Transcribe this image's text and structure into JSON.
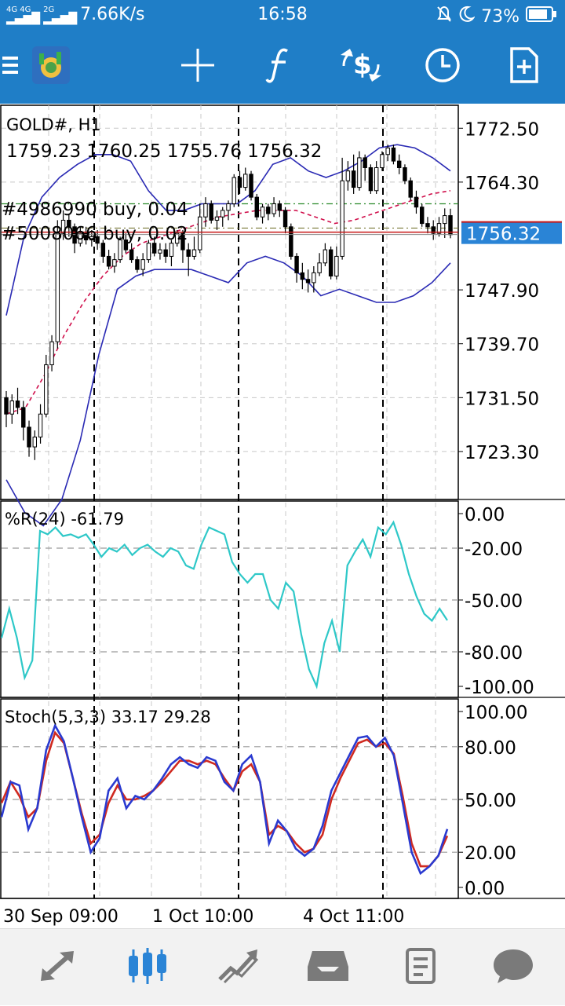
{
  "status_bar": {
    "network_top": "4G 4G",
    "network_2g": "2G",
    "speed": "7.66K/s",
    "time": "16:58",
    "battery": "73%"
  },
  "toolbar": {
    "icons": [
      "menu-icon",
      "app-logo-icon",
      "crosshair-icon",
      "function-icon",
      "trade-icon",
      "clock-icon",
      "new-document-icon"
    ]
  },
  "chart": {
    "symbol": "GOLD#, H1",
    "ohlc": "1759.23 1760.25 1755.76 1756.32",
    "order1": "#4986990 buy, 0.04",
    "order2": "#5008066 buy, 0.02",
    "current_price": "1756.32",
    "price_ticks": [
      "1772.50",
      "1764.30",
      "1747.90",
      "1739.70",
      "1731.50",
      "1723.30"
    ],
    "wr_label": "%R(24) -61.79",
    "wr_ticks": [
      "0.00",
      "-20.00",
      "-50.00",
      "-80.00",
      "-100.00"
    ],
    "stoch_label": "Stoch(5,3,3) 33.17 29.28",
    "stoch_ticks": [
      "100.00",
      "80.00",
      "50.00",
      "20.00",
      "0.00"
    ],
    "time_labels": [
      "30 Sep 09:00",
      "1 Oct 10:00",
      "4 Oct 11:00"
    ],
    "colors": {
      "bullish_body": "#ffffff",
      "bearish_body": "#000000",
      "bollinger": "#2a2ab4",
      "ma": "#d0104c",
      "wr_line": "#2ec8c8",
      "stoch_main": "#2a3ad0",
      "stoch_signal": "#d02a20",
      "price_marker_bg": "#2a84d6",
      "order_line": "#c81818"
    }
  },
  "chart_data": [
    {
      "type": "candlestick",
      "title": "GOLD#, H1",
      "ylim": [
        1716.0,
        1776.0
      ],
      "y_ticks": [
        1772.5,
        1764.3,
        1747.9,
        1739.7,
        1731.5,
        1723.3
      ],
      "current_price": 1756.32,
      "candles": [
        [
          1731.5,
          1729.0,
          1732.5,
          1727.0
        ],
        [
          1729.0,
          1731.0,
          1732.0,
          1727.5
        ],
        [
          1731.0,
          1730.0,
          1733.0,
          1729.0
        ],
        [
          1730.0,
          1727.0,
          1731.0,
          1725.0
        ],
        [
          1727.0,
          1724.0,
          1728.0,
          1722.5
        ],
        [
          1724.0,
          1725.5,
          1726.5,
          1722.0
        ],
        [
          1725.5,
          1729.0,
          1730.5,
          1724.5
        ],
        [
          1729.0,
          1736.5,
          1738.0,
          1728.5
        ],
        [
          1736.5,
          1740.0,
          1741.0,
          1735.5
        ],
        [
          1740.0,
          1756.5,
          1758.5,
          1739.0
        ],
        [
          1756.5,
          1758.5,
          1760.0,
          1755.5
        ],
        [
          1758.5,
          1757.5,
          1759.5,
          1756.0
        ],
        [
          1757.5,
          1755.0,
          1758.0,
          1753.5
        ],
        [
          1755.0,
          1756.5,
          1757.5,
          1754.5
        ],
        [
          1756.5,
          1755.5,
          1757.5,
          1754.8
        ],
        [
          1755.5,
          1756.0,
          1757.0,
          1754.5
        ],
        [
          1756.0,
          1755.0,
          1757.0,
          1754.0
        ],
        [
          1755.0,
          1753.0,
          1755.5,
          1752.0
        ],
        [
          1753.0,
          1751.5,
          1754.0,
          1751.0
        ],
        [
          1751.5,
          1752.5,
          1753.5,
          1750.5
        ],
        [
          1752.5,
          1755.5,
          1756.0,
          1752.0
        ],
        [
          1755.5,
          1754.0,
          1756.5,
          1753.5
        ],
        [
          1754.0,
          1752.5,
          1755.0,
          1752.0
        ],
        [
          1752.5,
          1751.0,
          1753.0,
          1750.5
        ],
        [
          1751.0,
          1752.5,
          1753.5,
          1750.0
        ],
        [
          1752.5,
          1755.0,
          1755.5,
          1752.0
        ],
        [
          1755.0,
          1753.5,
          1756.0,
          1753.0
        ],
        [
          1753.5,
          1754.0,
          1755.0,
          1752.5
        ],
        [
          1754.0,
          1753.0,
          1755.0,
          1752.0
        ],
        [
          1753.0,
          1755.0,
          1755.5,
          1751.5
        ],
        [
          1755.0,
          1756.5,
          1757.0,
          1754.5
        ],
        [
          1756.5,
          1754.0,
          1757.0,
          1752.0
        ],
        [
          1754.0,
          1753.0,
          1755.0,
          1750.0
        ],
        [
          1753.0,
          1754.0,
          1756.0,
          1752.5
        ],
        [
          1754.0,
          1759.0,
          1761.0,
          1753.5
        ],
        [
          1759.0,
          1761.0,
          1762.0,
          1757.5
        ],
        [
          1761.0,
          1758.5,
          1761.5,
          1758.0
        ],
        [
          1758.5,
          1759.0,
          1760.0,
          1757.0
        ],
        [
          1759.0,
          1760.0,
          1760.5,
          1757.5
        ],
        [
          1760.0,
          1761.0,
          1761.5,
          1758.5
        ],
        [
          1761.0,
          1765.0,
          1765.5,
          1760.5
        ],
        [
          1765.0,
          1763.5,
          1766.0,
          1762.5
        ],
        [
          1763.5,
          1765.5,
          1766.5,
          1763.0
        ],
        [
          1765.5,
          1762.0,
          1766.0,
          1761.5
        ],
        [
          1762.0,
          1759.0,
          1762.5,
          1758.5
        ],
        [
          1759.0,
          1760.5,
          1761.0,
          1758.0
        ],
        [
          1760.5,
          1759.5,
          1761.0,
          1758.5
        ],
        [
          1759.5,
          1761.0,
          1762.0,
          1759.0
        ],
        [
          1761.0,
          1760.0,
          1761.5,
          1759.0
        ],
        [
          1760.0,
          1757.5,
          1760.5,
          1756.5
        ],
        [
          1757.5,
          1753.0,
          1758.0,
          1752.5
        ],
        [
          1753.0,
          1750.5,
          1753.5,
          1749.0
        ],
        [
          1750.5,
          1749.5,
          1752.0,
          1748.0
        ],
        [
          1749.5,
          1749.0,
          1751.0,
          1747.5
        ],
        [
          1749.0,
          1750.5,
          1751.5,
          1747.5
        ],
        [
          1750.5,
          1752.0,
          1753.5,
          1750.0
        ],
        [
          1752.0,
          1754.0,
          1755.0,
          1751.5
        ],
        [
          1754.0,
          1750.0,
          1754.5,
          1749.5
        ],
        [
          1750.0,
          1753.0,
          1754.5,
          1749.5
        ],
        [
          1753.0,
          1764.5,
          1768.0,
          1752.5
        ],
        [
          1764.5,
          1766.0,
          1767.5,
          1763.0
        ],
        [
          1766.0,
          1763.5,
          1768.5,
          1762.5
        ],
        [
          1763.5,
          1768.0,
          1769.0,
          1763.0
        ],
        [
          1768.0,
          1766.5,
          1768.5,
          1764.5
        ],
        [
          1766.5,
          1763.0,
          1767.0,
          1762.5
        ],
        [
          1763.0,
          1766.5,
          1767.5,
          1762.5
        ],
        [
          1766.5,
          1768.5,
          1769.0,
          1766.0
        ],
        [
          1768.5,
          1769.5,
          1770.0,
          1767.5
        ],
        [
          1769.5,
          1767.5,
          1770.0,
          1767.0
        ],
        [
          1767.5,
          1766.5,
          1768.5,
          1765.5
        ],
        [
          1766.5,
          1764.5,
          1767.0,
          1764.0
        ],
        [
          1764.5,
          1762.0,
          1765.0,
          1761.5
        ],
        [
          1762.0,
          1760.5,
          1763.0,
          1759.5
        ],
        [
          1760.5,
          1758.0,
          1761.0,
          1757.5
        ],
        [
          1758.0,
          1757.5,
          1759.0,
          1756.5
        ],
        [
          1757.5,
          1756.5,
          1758.5,
          1755.5
        ],
        [
          1756.5,
          1758.0,
          1759.0,
          1756.0
        ],
        [
          1758.0,
          1759.2,
          1760.3,
          1755.8
        ],
        [
          1759.2,
          1756.3,
          1760.25,
          1755.76
        ]
      ],
      "orders": [
        1761.0,
        1757.3
      ],
      "bollinger_upper": [
        1744,
        1756,
        1762,
        1765,
        1767,
        1768.5,
        1768.5,
        1767.5,
        1763,
        1760,
        1760,
        1761,
        1761,
        1761,
        1763,
        1767,
        1768,
        1766,
        1765,
        1766,
        1767.5,
        1769.5,
        1770,
        1769.5,
        1768,
        1766
      ],
      "bollinger_middle": [
        1729,
        1730,
        1735,
        1741,
        1746,
        1750,
        1753,
        1755,
        1756,
        1757,
        1758,
        1759,
        1759.5,
        1760,
        1760,
        1760,
        1759,
        1758,
        1758.5,
        1759.5,
        1760.5,
        1761.5,
        1762.5,
        1763
      ],
      "bollinger_lower": [
        1719,
        1714,
        1712,
        1716,
        1725,
        1738,
        1748,
        1750,
        1751,
        1751,
        1751,
        1750,
        1749,
        1752,
        1753,
        1752,
        1750,
        1747,
        1748,
        1747,
        1746,
        1746,
        1747,
        1749,
        1752
      ],
      "x_labels": [
        "30 Sep 09:00",
        "1 Oct 10:00",
        "4 Oct 11:00"
      ]
    },
    {
      "type": "line",
      "title": "%R(24) -61.79",
      "ylim": [
        -100,
        0
      ],
      "y_ticks": [
        0,
        -20,
        -50,
        -80,
        -100
      ],
      "series": [
        {
          "name": "%R(24)",
          "values": [
            -72,
            -55,
            -72,
            -95,
            -85,
            -10,
            -12,
            -8,
            -13,
            -12,
            -14,
            -12,
            -18,
            -25,
            -20,
            -22,
            -18,
            -24,
            -20,
            -18,
            -22,
            -25,
            -20,
            -22,
            -30,
            -32,
            -18,
            -8,
            -10,
            -12,
            -28,
            -35,
            -40,
            -35,
            -35,
            -50,
            -55,
            -40,
            -45,
            -70,
            -90,
            -100,
            -75,
            -62,
            -80,
            -30,
            -22,
            -15,
            -25,
            -8,
            -12,
            -5,
            -18,
            -35,
            -48,
            -58,
            -62,
            -55,
            -61.79
          ]
        }
      ]
    },
    {
      "type": "line",
      "title": "Stoch(5,3,3) 33.17 29.28",
      "ylim": [
        0,
        100
      ],
      "y_ticks": [
        100,
        80,
        50,
        20,
        0
      ],
      "series": [
        {
          "name": "main",
          "values": [
            40,
            60,
            58,
            33,
            45,
            78,
            92,
            83,
            62,
            40,
            20,
            28,
            55,
            62,
            45,
            52,
            50,
            55,
            62,
            70,
            74,
            70,
            68,
            74,
            72,
            60,
            55,
            70,
            75,
            60,
            25,
            38,
            32,
            22,
            18,
            22,
            35,
            55,
            65,
            75,
            85,
            86,
            80,
            85,
            75,
            48,
            20,
            8,
            12,
            18,
            33.17
          ]
        },
        {
          "name": "signal",
          "values": [
            48,
            60,
            52,
            40,
            45,
            72,
            88,
            82,
            62,
            42,
            25,
            30,
            48,
            58,
            50,
            50,
            52,
            55,
            60,
            66,
            72,
            72,
            70,
            72,
            70,
            62,
            55,
            66,
            70,
            60,
            30,
            35,
            32,
            25,
            20,
            22,
            30,
            50,
            62,
            72,
            82,
            84,
            80,
            82,
            76,
            52,
            25,
            12,
            12,
            18,
            29.28
          ]
        }
      ]
    }
  ]
}
